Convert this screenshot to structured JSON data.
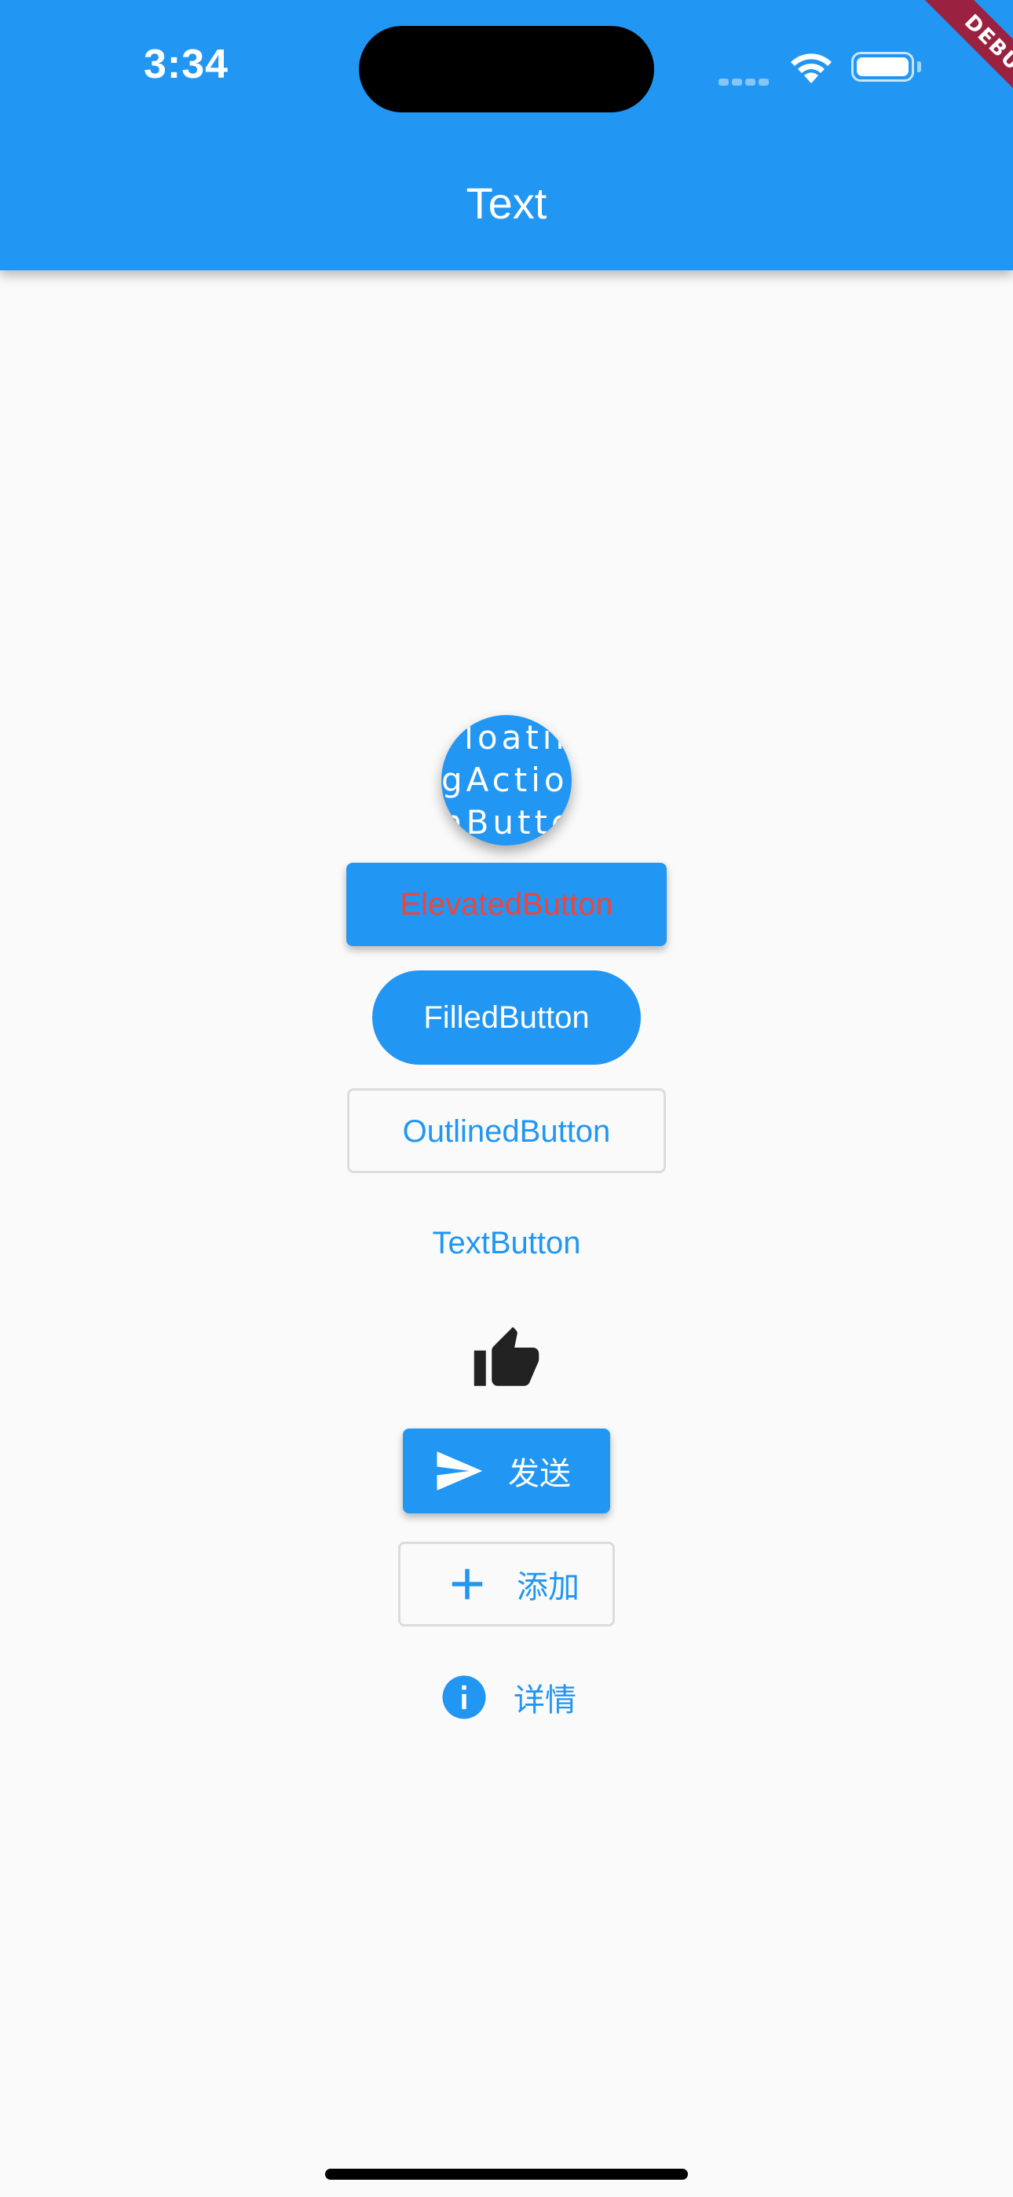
{
  "status_bar": {
    "time": "3:34"
  },
  "app_bar": {
    "title": "Text"
  },
  "debug_banner": "DEBUG",
  "buttons": {
    "fab_label": "Floatin\ngActio\nnButto",
    "elevated_label": "ElevatedButton",
    "filled_label": "FilledButton",
    "outlined_label": "OutlinedButton",
    "text_label": "TextButton",
    "icon_button_icon": "thumb-up-icon",
    "send_label": "发送",
    "send_icon": "send-icon",
    "add_label": "添加",
    "add_icon": "plus-icon",
    "info_label": "详情",
    "info_icon": "info-icon"
  },
  "colors": {
    "primary": "#2196f3",
    "elevated_text": "#f44336",
    "background": "#fafafa",
    "debug": "#9b2140"
  }
}
